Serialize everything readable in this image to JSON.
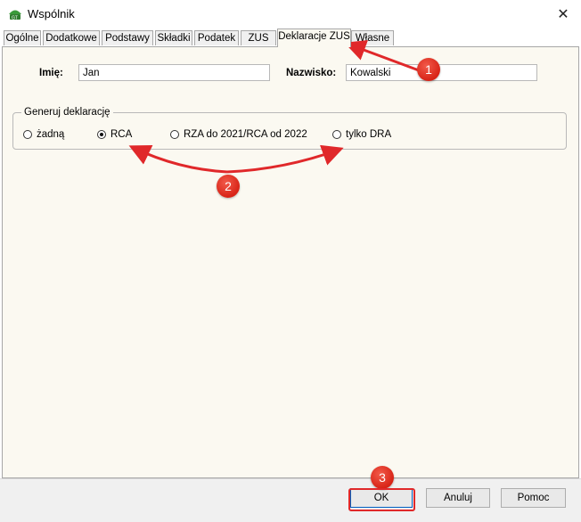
{
  "window": {
    "title": "Wspólnik",
    "close_glyph": "✕",
    "icon": "app-logo-icon"
  },
  "tabs": [
    {
      "label": "Ogólne",
      "active": false
    },
    {
      "label": "Dodatkowe",
      "active": false
    },
    {
      "label": "Podstawy",
      "active": false
    },
    {
      "label": "Składki",
      "active": false
    },
    {
      "label": "Podatek",
      "active": false
    },
    {
      "label": "ZUS",
      "active": false
    },
    {
      "label": "Deklaracje ZUS",
      "active": true
    },
    {
      "label": "Własne",
      "active": false
    }
  ],
  "form": {
    "first_name_label": "Imię:",
    "first_name_value": "Jan",
    "last_name_label": "Nazwisko:",
    "last_name_value": "Kowalski"
  },
  "declaration_group": {
    "title": "Generuj deklarację",
    "options": [
      {
        "label": "żadną",
        "checked": false
      },
      {
        "label": "RCA",
        "checked": true
      },
      {
        "label": "RZA do 2021/RCA od 2022",
        "checked": false
      },
      {
        "label": "tylko DRA",
        "checked": false
      }
    ]
  },
  "buttons": {
    "ok": "OK",
    "cancel": "Anuluj",
    "help": "Pomoc"
  },
  "annotations": {
    "badge_1": "1",
    "badge_2": "2",
    "badge_3": "3",
    "color": "#e0282a"
  }
}
